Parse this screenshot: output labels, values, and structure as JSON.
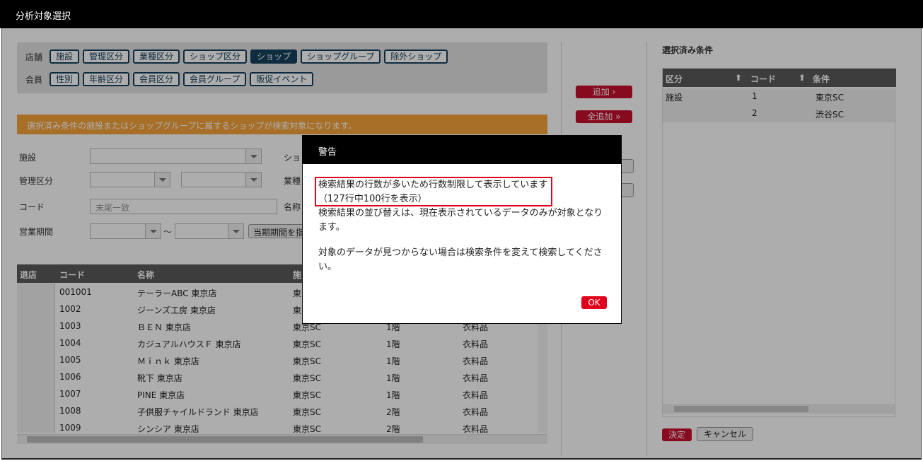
{
  "window": {
    "title": "分析対象選択"
  },
  "filters": {
    "shop_label": "店舗",
    "shop_tags": [
      "施設",
      "管理区分",
      "業種区分",
      "ショップ区分",
      "ショップ",
      "ショップグループ",
      "除外ショップ"
    ],
    "member_label": "会員",
    "member_tags": [
      "性別",
      "年齢区分",
      "会員区分",
      "会員グループ",
      "販促イベント"
    ],
    "active_tag": "ショップ"
  },
  "notice": "選択済み条件の施設またはショップグループに属するショップが検索対象になります。",
  "form": {
    "facility_label": "施設",
    "shop_label": "ショ",
    "mgmt_label": "管理区分",
    "industry_label": "業種",
    "code_label": "コード",
    "code_placeholder": "末尾一致",
    "name_label": "名称",
    "period_label": "営業期間",
    "tilde": "～",
    "period_button": "当期期間を指"
  },
  "grid": {
    "headers": [
      "退店",
      "コード",
      "名称",
      "施"
    ],
    "rows": [
      [
        "001001",
        "テーラーABC 東京店",
        "東",
        "",
        ""
      ],
      [
        "1002",
        "ジーンズ工房 東京店",
        "東",
        "",
        ""
      ],
      [
        "1003",
        "ＢＥＮ 東京店",
        "東京SC",
        "1階",
        "衣料品"
      ],
      [
        "1004",
        "カジュアルハウスＦ 東京店",
        "東京SC",
        "1階",
        "衣料品"
      ],
      [
        "1005",
        "Ｍｉｎｋ 東京店",
        "東京SC",
        "1階",
        "衣料品"
      ],
      [
        "1006",
        "靴下 東京店",
        "東京SC",
        "1階",
        "衣料品"
      ],
      [
        "1007",
        "PINE 東京店",
        "東京SC",
        "1階",
        "衣料品"
      ],
      [
        "1008",
        "子供服チャイルドランド 東京店",
        "東京SC",
        "2階",
        "衣料品"
      ],
      [
        "1009",
        "シンシア 東京店",
        "東京SC",
        "2階",
        "衣料品"
      ]
    ]
  },
  "actions": {
    "add": "追加 ›",
    "add_all": "全追加 »"
  },
  "selected": {
    "title": "選択済み条件",
    "headers": [
      "区分",
      "コード",
      "条件"
    ],
    "rows": [
      [
        "施設",
        "1",
        "東京SC"
      ],
      [
        "",
        "2",
        "渋谷SC"
      ]
    ],
    "confirm": "決定",
    "cancel": "キャンセル"
  },
  "modal": {
    "title": "警告",
    "line1": "検索結果の行数が多いため行数制限して表示しています",
    "line2": "（127行中100行を表示）",
    "line3": "検索結果の並び替えは、現在表示されているデータのみが対象となり",
    "line4": "ます。",
    "line5": "対象のデータが見つからない場合は検索条件を変えて検索してくださ",
    "line6": "い。",
    "ok": "OK"
  },
  "colors": {
    "accent_navy": "#17405e",
    "notice_orange": "#f6a43a",
    "danger_red": "#e0001b"
  }
}
